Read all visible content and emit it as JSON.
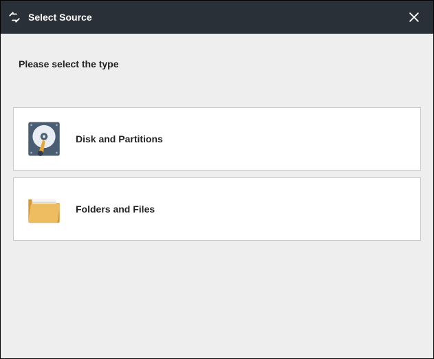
{
  "titlebar": {
    "title": "Select Source"
  },
  "main": {
    "prompt": "Please select the type",
    "options": [
      {
        "label": "Disk and Partitions"
      },
      {
        "label": "Folders and Files"
      }
    ]
  }
}
